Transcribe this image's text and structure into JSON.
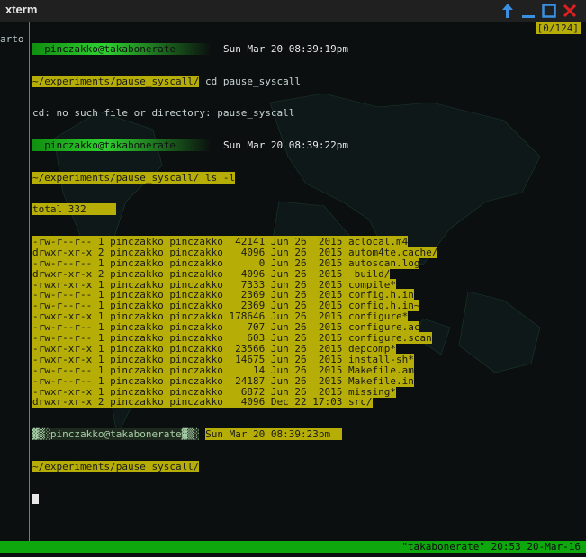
{
  "window": {
    "title": "xterm",
    "buttons": [
      {
        "name": "up-arrow-icon",
        "color": "#3a8fe0"
      },
      {
        "name": "minimize-icon",
        "color": "#3a8fe0"
      },
      {
        "name": "maximize-icon",
        "color": "#3a8fe0"
      },
      {
        "name": "close-icon",
        "color": "#e02020"
      }
    ]
  },
  "terminal": {
    "left_fragment": "arto",
    "counter": "[0/124]",
    "prompt1": {
      "user": "pinczakko@takabonerate",
      "date": "Sun Mar 20 08:39:19pm"
    },
    "cmd1": "~/experiments/pause_syscall/ cd pause_syscall",
    "err1": "cd: no such file or directory: pause_syscall",
    "prompt2": {
      "user": "pinczakko@takabonerate",
      "date": "Sun Mar 20 08:39:22pm"
    },
    "cmd2": "~/experiments/pause_syscall/ ls -l",
    "total": "total 332",
    "files": [
      "-rw-r--r-- 1 pinczakko pinczakko  42141 Jun 26  2015 aclocal.m4",
      "drwxr-xr-x 2 pinczakko pinczakko   4096 Jun 26  2015 autom4te.cache/",
      "-rw-r--r-- 1 pinczakko pinczakko      0 Jun 26  2015 autoscan.log",
      "drwxr-xr-x 2 pinczakko pinczakko   4096 Jun 26  2015 _build/",
      "-rwxr-xr-x 1 pinczakko pinczakko   7333 Jun 26  2015 compile*",
      "-rw-r--r-- 1 pinczakko pinczakko   2369 Jun 26  2015 config.h.in",
      "-rw-r--r-- 1 pinczakko pinczakko   2369 Jun 26  2015 config.h.in~",
      "-rwxr-xr-x 1 pinczakko pinczakko 178646 Jun 26  2015 configure*",
      "-rw-r--r-- 1 pinczakko pinczakko    707 Jun 26  2015 configure.ac",
      "-rw-r--r-- 1 pinczakko pinczakko    603 Jun 26  2015 configure.scan",
      "-rwxr-xr-x 1 pinczakko pinczakko  23566 Jun 26  2015 depcomp*",
      "-rwxr-xr-x 1 pinczakko pinczakko  14675 Jun 26  2015 install-sh*",
      "-rw-r--r-- 1 pinczakko pinczakko     14 Jun 26  2015 Makefile.am",
      "-rw-r--r-- 1 pinczakko pinczakko  24187 Jun 26  2015 Makefile.in",
      "-rwxr-xr-x 1 pinczakko pinczakko   6872 Jun 26  2015 missing*",
      "drwxr-xr-x 2 pinczakko pinczakko   4096 Dec 22 17:03 src/"
    ],
    "prompt3": {
      "user": "pinczakko@takabonerate",
      "date": "Sun Mar 20 08:39:23pm"
    },
    "cmd3": "~/experiments/pause_syscall/"
  },
  "statusbar": {
    "text": "\"takabonerate\" 20:53 20-Mar-16"
  }
}
